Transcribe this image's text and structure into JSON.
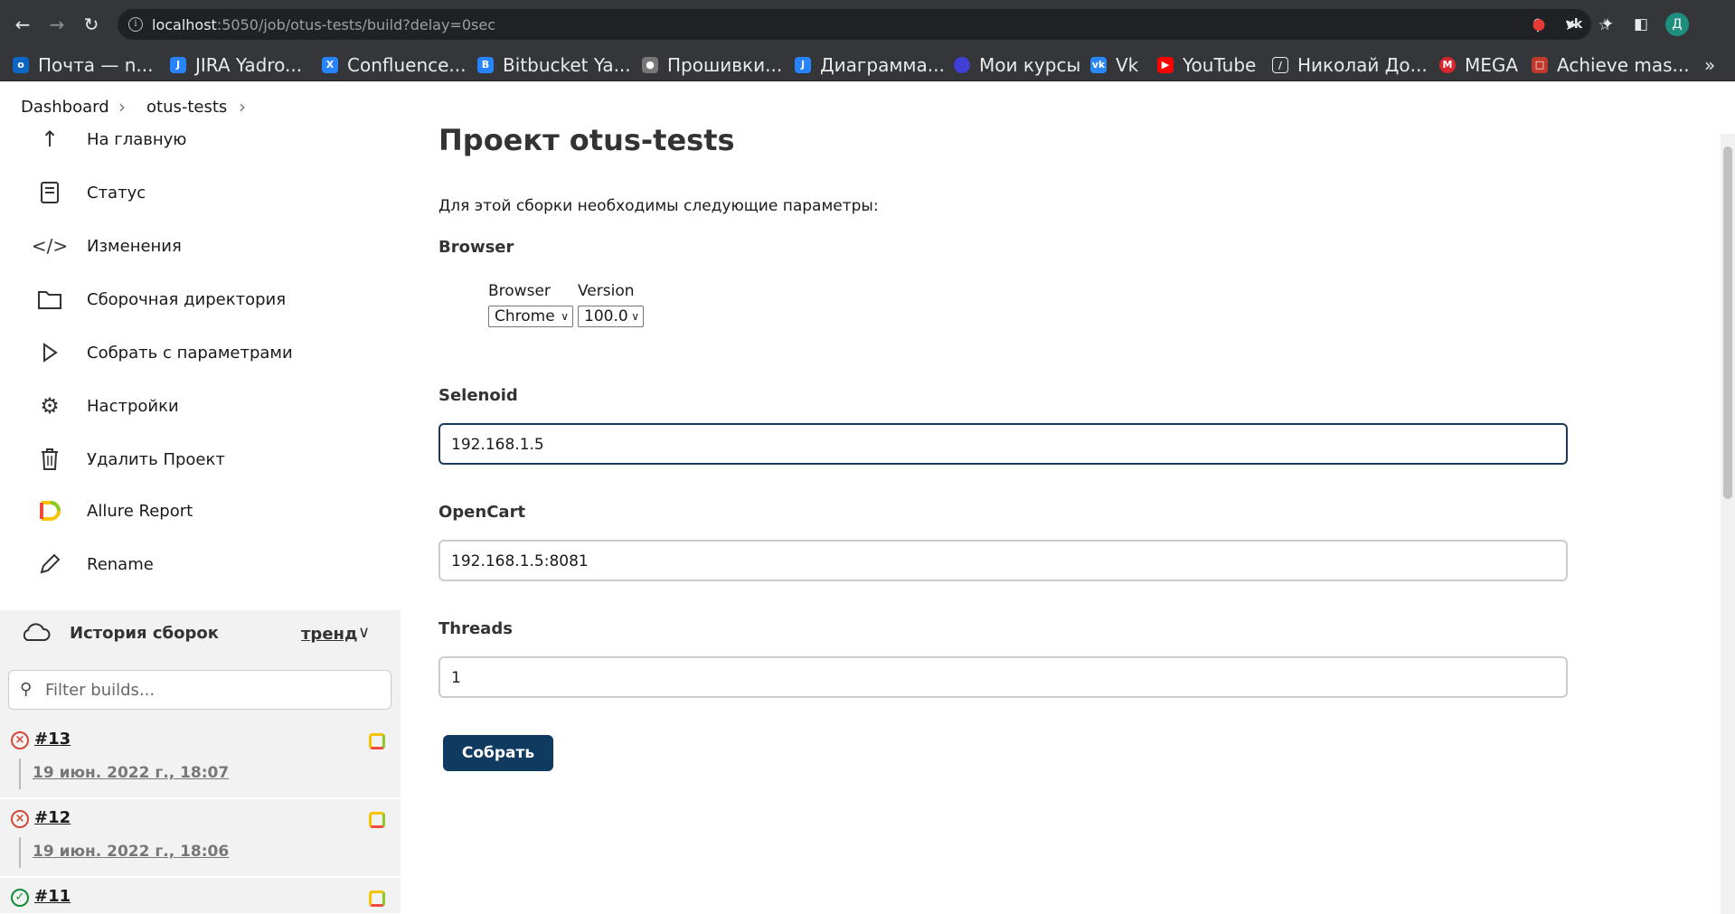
{
  "browser": {
    "url_host": "localhost",
    "url_rest": ":5050/job/otus-tests/build?delay=0sec",
    "profile_initial": "Д",
    "bookmarks": [
      {
        "label": "Почта — n...",
        "color": "#0a66c2",
        "icon": "mail-icon"
      },
      {
        "label": "JIRA Yadro...",
        "color": "#2684ff",
        "icon": "jira-icon"
      },
      {
        "label": "Confluence...",
        "color": "#2684ff",
        "icon": "confluence-icon"
      },
      {
        "label": "Bitbucket Ya...",
        "color": "#2684ff",
        "icon": "bitbucket-icon"
      },
      {
        "label": "Прошивки...",
        "color": "#777777",
        "icon": "globe-icon"
      },
      {
        "label": "Диаграмма...",
        "color": "#2684ff",
        "icon": "jira-icon"
      },
      {
        "label": "Мои курсы",
        "color": "#3f3fd6",
        "icon": "courses-icon"
      },
      {
        "label": "Vk",
        "color": "#2787f5",
        "icon": "vk-icon"
      },
      {
        "label": "YouTube",
        "color": "#ff0000",
        "icon": "youtube-icon"
      },
      {
        "label": "Николай До...",
        "color": "#e8eaed",
        "icon": "link-icon"
      },
      {
        "label": "MEGA",
        "color": "#d9272e",
        "icon": "mega-icon"
      },
      {
        "label": "Achieve mas...",
        "color": "#c0392b",
        "icon": "book-icon"
      }
    ],
    "bookmarks_more": "»"
  },
  "breadcrumb": {
    "items": [
      "Dashboard",
      "otus-tests"
    ]
  },
  "sidebar": {
    "tasks": [
      {
        "label": "На главную",
        "icon": "arrow-up-icon"
      },
      {
        "label": "Статус",
        "icon": "document-icon"
      },
      {
        "label": "Изменения",
        "icon": "code-icon"
      },
      {
        "label": "Сборочная директория",
        "icon": "folder-icon"
      },
      {
        "label": "Собрать с параметрами",
        "icon": "play-icon"
      },
      {
        "label": "Настройки",
        "icon": "gear-icon"
      },
      {
        "label": "Удалить Проект",
        "icon": "trash-icon"
      },
      {
        "label": "Allure Report",
        "icon": "allure-icon"
      },
      {
        "label": "Rename",
        "icon": "pencil-icon"
      }
    ],
    "history": {
      "title": "История сборок",
      "trend": "тренд",
      "filter_placeholder": "Filter builds...",
      "builds": [
        {
          "number": "#13",
          "date": "19 июн. 2022 г., 18:07",
          "status": "failed"
        },
        {
          "number": "#12",
          "date": "19 июн. 2022 г., 18:06",
          "status": "failed"
        },
        {
          "number": "#11",
          "date": "",
          "status": "success"
        }
      ]
    }
  },
  "main": {
    "title": "Проект otus-tests",
    "description": "Для этой сборки необходимы следующие параметры:",
    "browser_param": {
      "label": "Browser",
      "columns": [
        {
          "header": "Browser",
          "value": "Chrome"
        },
        {
          "header": "Version",
          "value": "100.0"
        }
      ]
    },
    "selenoid": {
      "label": "Selenoid",
      "value": "192.168.1.5"
    },
    "opencart": {
      "label": "OpenCart",
      "value": "192.168.1.5:8081"
    },
    "threads": {
      "label": "Threads",
      "value": "1"
    },
    "submit_label": "Собрать"
  }
}
